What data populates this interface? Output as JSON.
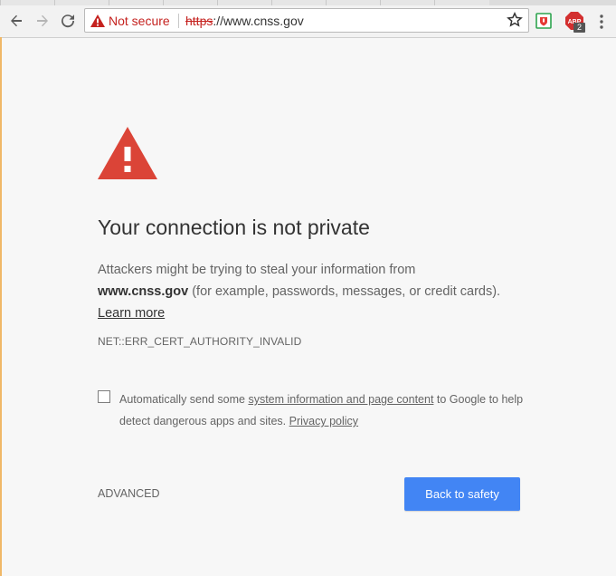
{
  "browser": {
    "security_label": "Not secure",
    "url_scheme": "https",
    "url_rest": "://www.cnss.gov",
    "abp_badge_count": "2",
    "abp_label": "ABP"
  },
  "page": {
    "heading": "Your connection is not private",
    "body_prefix": "Attackers might be trying to steal your information from",
    "domain": "www.cnss.gov",
    "body_suffix": " (for example, passwords, messages, or credit cards).",
    "learn_more": "Learn more",
    "error_code": "NET::ERR_CERT_AUTHORITY_INVALID",
    "optin_prefix": "Automatically send some ",
    "optin_link": "system information and page content",
    "optin_middle": " to Google to help detect dangerous apps and sites. ",
    "privacy_link": "Privacy policy",
    "advanced_label": "ADVANCED",
    "back_button_label": "Back to safety"
  },
  "colors": {
    "warning_red": "#db4437",
    "button_blue": "#4285f4",
    "not_secure_red": "#c5221f"
  },
  "icons": {
    "back": "back-arrow-icon",
    "forward": "forward-arrow-icon",
    "reload": "reload-icon",
    "warning": "warning-triangle-icon",
    "star": "bookmark-star-icon",
    "menu": "kebab-menu-icon"
  }
}
